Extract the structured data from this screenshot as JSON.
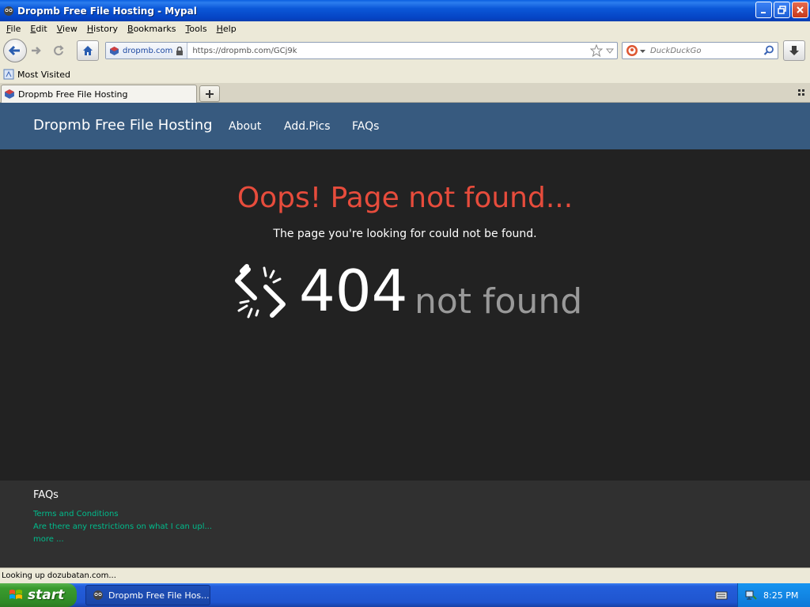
{
  "window": {
    "title": "Dropmb Free File Hosting - Mypal"
  },
  "menubar": {
    "items": [
      "File",
      "Edit",
      "View",
      "History",
      "Bookmarks",
      "Tools",
      "Help"
    ]
  },
  "navbar": {
    "identity": "dropmb.com",
    "url": "https://dropmb.com/GCj9k",
    "search_placeholder": "DuckDuckGo"
  },
  "bookmarks": {
    "items": [
      "Most Visited"
    ]
  },
  "tabs": [
    {
      "label": "Dropmb Free File Hosting"
    }
  ],
  "site": {
    "brand": "Dropmb Free File Hosting",
    "nav": [
      "About",
      "Add.Pics",
      "FAQs"
    ],
    "error_title": "Oops! Page not found...",
    "error_subtitle": "The page you're looking for could not be found.",
    "error_code": "404",
    "error_text": "not found",
    "footer": {
      "title": "FAQs",
      "links": [
        "Terms and Conditions",
        "Are there any restrictions on what I can upl...",
        "more ..."
      ]
    }
  },
  "status": {
    "text": "Looking up dozubatan.com..."
  },
  "taskbar": {
    "start_label": "start",
    "task_label": "Dropmb Free File Hos...",
    "clock": "8:25 PM"
  },
  "colors": {
    "site_nav_bg": "#375a7f",
    "error_red": "#e74c3c",
    "link_green": "#00bc8c",
    "page_bg": "#222222"
  }
}
